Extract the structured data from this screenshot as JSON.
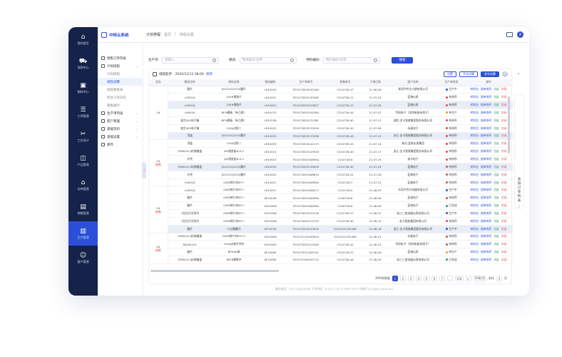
{
  "rail": [
    {
      "label": "我的首页",
      "icon": "home-icon"
    },
    {
      "label": "采购中心",
      "icon": "cart-icon"
    },
    {
      "label": "物料中心",
      "icon": "box-icon"
    },
    {
      "label": "工序管理",
      "icon": "list-icon"
    },
    {
      "label": "工艺设计",
      "icon": "tools-icon"
    },
    {
      "label": "产品管理",
      "icon": "product-icon"
    },
    {
      "label": "仓库管理",
      "icon": "warehouse-icon"
    },
    {
      "label": "销售管理",
      "icon": "sales-icon"
    },
    {
      "label": "生产管理",
      "icon": "factory-icon"
    },
    {
      "label": "客户管理",
      "icon": "user-icon"
    }
  ],
  "header": {
    "logo": "中特云系统",
    "crumb_root": "计划排程",
    "crumb_1": "首页",
    "crumb_2": "排程设置",
    "user_initial": "A"
  },
  "sidebar": {
    "items": [
      {
        "label": "销售订单列表"
      },
      {
        "label": "计划排程"
      },
      {
        "label": "生产单列表"
      },
      {
        "label": "客户管理"
      },
      {
        "label": "基础资料"
      },
      {
        "label": "基础设置"
      },
      {
        "label": "库存"
      }
    ],
    "subs": [
      "计划排程",
      "排程试算",
      "排程看板表",
      "机台工作日历",
      "看板展示"
    ]
  },
  "filters": {
    "l1": "生产单:",
    "p1": "请输入",
    "l2": "模具:",
    "p2": "模具编号/名称",
    "l3": "物料编码:",
    "p3": "物料编码/名称",
    "search": "搜索"
  },
  "panel": {
    "label": "排程起手:",
    "datetime": "2020/12/12 08:00",
    "modify": "修改",
    "b1": "设置",
    "b2": "手动试算",
    "b3": "发布试算",
    "help": "?"
  },
  "columns": [
    "机台",
    "模具名称",
    "物料名称",
    "物料编码",
    "生产单单号",
    "销售单号",
    "下单日期",
    "客户名称",
    "生产单状态",
    "操作"
  ],
  "groups": [
    {
      "name": "1#",
      "sub": "",
      "rows": 7
    },
    {
      "name": "2#",
      "sub": "故障",
      "rows": 6
    },
    {
      "name": "3#",
      "sub": "故障",
      "rows": 6
    },
    {
      "name": "4#",
      "sub": "故障",
      "rows": 6
    },
    {
      "name": "5#",
      "sub": "故障",
      "rows": 4
    },
    {
      "name": "6#",
      "sub": "故障",
      "rows": 3
    }
  ],
  "rows": [
    {
      "mold": "翻片",
      "mat": "JD1015(2015)翻片",
      "code": "LH10024",
      "po": "P21072615132184",
      "so": "C210726-47",
      "date": "21-06-28",
      "cust": "湖北利宇达卡塑有限公司",
      "status": "生产中",
      "color": "#2c4fd8",
      "hl": false
    },
    {
      "mold": "LH001A",
      "mat": "100#钢垫片",
      "code": "LH10021",
      "po": "P21072615145480",
      "so": "C210726-21",
      "date": "21-07-01",
      "cust": "蓝格仪表",
      "status": "待排序",
      "color": "#e04848",
      "hl": false
    },
    {
      "mold": "LH001A",
      "mat": "100#钢垫片",
      "code": "LH10021",
      "po": "P21072615133637",
      "so": "C210726-21",
      "date": "21-07-05",
      "cust": "蓝格仪表",
      "status": "待排序",
      "color": "#e04848",
      "hl": true
    },
    {
      "mold": "LH001A",
      "mat": "BFM模板（有凸筋）",
      "code": "LH10133",
      "po": "P21072615144364",
      "so": "C210726-44",
      "date": "21-07-07",
      "cust": "华阳电子（深圳制造有限子）",
      "status": "待生产",
      "color": "#f0a020",
      "hl": false
    },
    {
      "mold": "波芯400电子箱",
      "mat": "BFM模板（有凸筋）",
      "code": "LH10138",
      "po": "P21072615131381",
      "so": "C210726-40",
      "date": "21-07-11",
      "cust": "湖北-金卡智能集团股份有限公司",
      "status": "待排序",
      "color": "#e04848",
      "hl": false
    },
    {
      "mold": "波芯400电子箱",
      "mat": "120A边框二",
      "code": "LH10022",
      "po": "P21072615133049",
      "so": "C210726-30",
      "date": "21-07-09",
      "cust": "永泰电子",
      "status": "待排序",
      "color": "#e04848",
      "hl": false
    },
    {
      "mold": "顶盖",
      "mat": "JD1015(2015)翻片",
      "code": "LH10023",
      "po": "P21072615133298",
      "so": "C210726-46",
      "date": "21-07-12",
      "cust": "浙江-金卡智能集团股份有限公司",
      "status": "待排序",
      "color": "#e04848",
      "hl": true
    },
    {
      "mold": "顶盖",
      "mat": "120A边框二",
      "code": "LH10009",
      "po": "P21072615142173",
      "so": "C210726-44",
      "date": "21-07-14",
      "cust": "湖北-蓝格仪表集团",
      "status": "待排序",
      "color": "#e04848",
      "hl": false
    },
    {
      "mold": "ZYB020-0封装翻盖",
      "mat": "JA5相底板N.S-2",
      "code": "LH10013",
      "po": "P21072615143920",
      "so": "C210726-40",
      "date": "21-07-17",
      "cust": "浙江-金卡智能集团股份有限公司",
      "status": "待排序",
      "color": "#e04848",
      "hl": false
    },
    {
      "mold": "外壳",
      "mat": "JA5相底板N.S-2",
      "code": "LH10013",
      "po": "P21072615446364",
      "so": "C210726-6",
      "date": "21-07-19",
      "cust": "迪丰电子",
      "status": "待排序",
      "color": "#e04848",
      "hl": false
    },
    {
      "mold": "ZYB020-0封装翻盖",
      "mat": "JD1015(2015)翻片",
      "code": "LH10023",
      "po": "P21072615136009",
      "so": "C210726-40",
      "date": "21-07-24",
      "cust": "蓝格电子",
      "status": "待排序",
      "color": "#e04848",
      "hl": true
    },
    {
      "mold": "外壳",
      "mat": "JD1015(2015)翻片",
      "code": "LH10020",
      "po": "P21072615448610",
      "so": "C210726-22",
      "date": "21-07-28",
      "cust": "蓝格电子",
      "status": "待排序",
      "color": "#e04848",
      "hl": false
    },
    {
      "mold": "LH001A",
      "mat": "0058铁片材NT+",
      "code": "LH10027",
      "po": "P21072615446364",
      "so": "C210726-7",
      "date": "21-07-31",
      "cust": "蓝格电子",
      "status": "待排序",
      "color": "#e04848",
      "hl": false
    },
    {
      "mold": "LH001A",
      "mat": "0058铁片材NT+",
      "code": "LH10027",
      "po": "P21072615438277",
      "so": "C210726-9",
      "date": "21-08-03",
      "cust": "东莞市合东电器有限公司",
      "status": "生产中",
      "color": "#2c4fd8",
      "hl": false
    },
    {
      "mold": "翻片",
      "mat": "0058铁片材NT+",
      "code": "AF10028",
      "po": "P21072615446364",
      "so": "C290726-6",
      "date": "21-08-06",
      "cust": "蓝格电子",
      "status": "待排序",
      "color": "#e04848",
      "hl": false
    },
    {
      "mold": "翻片",
      "mat": "0058铁片材NT+",
      "code": "HZ10006",
      "po": "P21072615446364",
      "so": "C290726-6",
      "date": "21-08-09",
      "cust": "蓝格电子",
      "status": "已完成",
      "color": "#22a35a",
      "hl": false
    },
    {
      "mold": "C型光开关系列",
      "mat": "0058铁片材NT+",
      "code": "HZ10006",
      "po": "P21072615133126",
      "so": "C210726-27",
      "date": "21-08-12",
      "cust": "浙江三变电器仪表有限公司",
      "status": "生产中",
      "color": "#2c4fd8",
      "hl": false
    },
    {
      "mold": "C型光开关系列",
      "mat": "0058铁片材NT+",
      "code": "HZ10006",
      "po": "P21072615121375",
      "so": "C210726-50",
      "date": "21-08-15",
      "cust": "金卡智能集团有限公司",
      "status": "待排序",
      "color": "#e04848",
      "hl": false
    },
    {
      "mold": "翻片",
      "mat": "75边翻翻片",
      "code": "AF10028",
      "po": "P21072615133534",
      "so": "S210722102496",
      "date": "21-08-18",
      "cust": "浙江-金卡智能集团股份有限公司",
      "status": "生产中",
      "color": "#2c4fd8",
      "hl": true
    },
    {
      "mold": "ZYB020-0封装翻盖",
      "mat": "0058铁片材NT+0",
      "code": "HZ10006",
      "po": "P21072210249554",
      "so": "S210722102496",
      "date": "21-08-21",
      "cust": "永泰电子",
      "status": "待排序",
      "color": "#e04848",
      "hl": false
    },
    {
      "mold": "MJ200212",
      "mat": "100A边框外壳件",
      "code": "HZ10045",
      "po": "P21072615124590",
      "so": "C210726-42",
      "date": "21-08-24",
      "cust": "华阳电子（深圳制造有限子）",
      "status": "待排序",
      "color": "#e04848",
      "hl": false
    },
    {
      "mold": "翻片",
      "mat": "BFM3A钢",
      "code": "AF10063",
      "po": "P21073021405741",
      "so": "C210726-22",
      "date": "21-08-26",
      "cust": "蓝格仪表",
      "status": "待生产",
      "color": "#f0a020",
      "hl": false
    },
    {
      "mold": "ZYB020-0封装翻盖",
      "mat": "BFE8钢铁件",
      "code": "AF10063",
      "po": "P21072294532712",
      "so": "C210726-46",
      "date": "21-08-29",
      "cust": "浙江三变电器仪表有限公司",
      "status": "已完成",
      "color": "#22a35a",
      "hl": false
    }
  ],
  "actions": [
    "转机台",
    "插单排序",
    "拉起",
    "关闭"
  ],
  "pager": {
    "total": "共99条数据",
    "pages": [
      "1",
      "2",
      "3",
      "4",
      "5",
      "6",
      "7",
      "...",
      "124"
    ],
    "next": ">",
    "per": "20条/页",
    "jump": "前往",
    "jump_val": "5",
    "jump_tail": "页"
  },
  "right_tab": "总排订单列表",
  "footer": "最佳电话：0571-81818186    工作时间：8:30-17:30    ©1999-2019 中端科 All rights reserved."
}
